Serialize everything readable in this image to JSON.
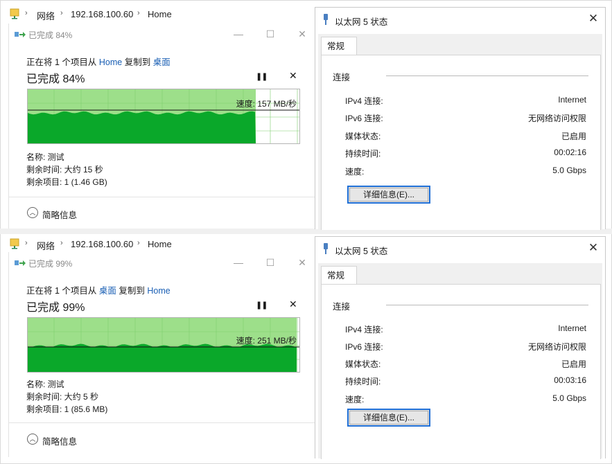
{
  "panels": [
    {
      "breadcrumb": [
        "网络",
        "192.168.100.60",
        "Home"
      ],
      "copy": {
        "title": "已完成 84%",
        "line_prefix": "正在将 1 个项目从",
        "source": "Home",
        "line_mid": "复制到",
        "dest": "桌面",
        "percent": "已完成 84%",
        "progress": 0.84,
        "pause": "❚❚",
        "stop": "✕",
        "speed": "速度: 157 MB/秒",
        "name": "名称: 测试",
        "time_left": "剩余时间: 大约 15 秒",
        "items_left": "剩余项目: 1 (1.46 GB)",
        "brief": "简略信息"
      },
      "eth": {
        "title": "以太网 5 状态",
        "tab": "常规",
        "group": "连接",
        "rows": [
          {
            "key": "IPv4 连接:",
            "val": "Internet"
          },
          {
            "key": "IPv6 连接:",
            "val": "无网络访问权限"
          },
          {
            "key": "媒体状态:",
            "val": "已启用"
          },
          {
            "key": "持续时间:",
            "val": "00:02:16"
          },
          {
            "key": "速度:",
            "val": "5.0 Gbps"
          }
        ],
        "details_btn": "详细信息(E)..."
      }
    },
    {
      "breadcrumb": [
        "网络",
        "192.168.100.60",
        "Home"
      ],
      "copy": {
        "title": "已完成 99%",
        "line_prefix": "正在将 1 个项目从",
        "source": "桌面",
        "line_mid": "复制到",
        "dest": "Home",
        "percent": "已完成 99%",
        "progress": 0.99,
        "pause": "❚❚",
        "stop": "✕",
        "speed": "速度: 251 MB/秒",
        "name": "名称: 测试",
        "time_left": "剩余时间: 大约 5 秒",
        "items_left": "剩余项目: 1 (85.6 MB)",
        "brief": "简略信息"
      },
      "eth": {
        "title": "以太网 5 状态",
        "tab": "常规",
        "group": "连接",
        "rows": [
          {
            "key": "IPv4 连接:",
            "val": "Internet"
          },
          {
            "key": "IPv6 连接:",
            "val": "无网络访问权限"
          },
          {
            "key": "媒体状态:",
            "val": "已启用"
          },
          {
            "key": "持续时间:",
            "val": "00:03:16"
          },
          {
            "key": "速度:",
            "val": "5.0 Gbps"
          }
        ],
        "details_btn": "详细信息(E)..."
      }
    }
  ],
  "colors": {
    "progress_fill": "#9ddf8a",
    "speed_area": "#0aa82a",
    "link": "#1a5fb4",
    "focus_border": "#1f6fd6"
  }
}
